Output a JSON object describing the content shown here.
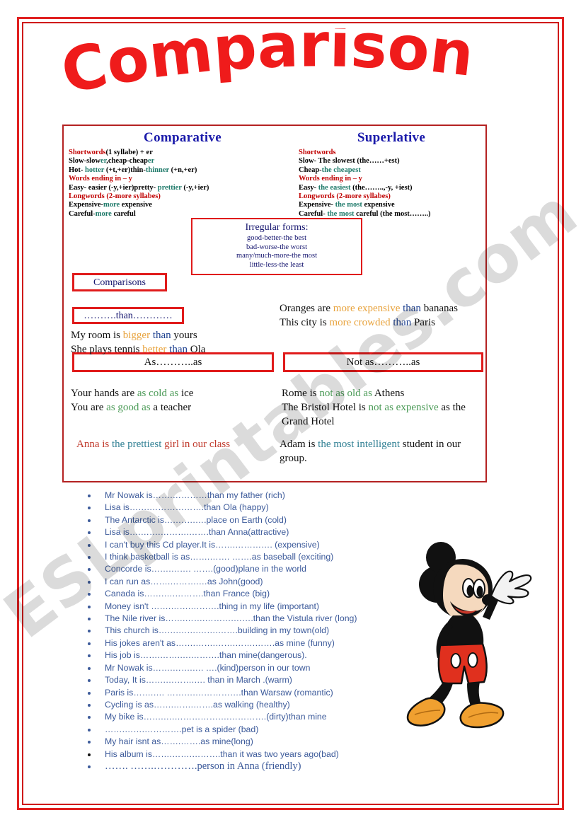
{
  "page": {
    "title": "Comparisons",
    "border_color": "#e02020",
    "box_border_color": "#b42222",
    "watermark": "ESLprintables.com"
  },
  "grammar_box": {
    "columns": [
      {
        "heading": "Comparative",
        "rules": [
          {
            "red": "Shortwords",
            "black": "(1 syllabe) + er"
          },
          {
            "black": "Slow-slow",
            "teal": "er",
            "black2": ",cheap-cheap",
            "teal2": "er"
          },
          {
            "black": "Hot- ",
            "teal": "hotter",
            "black2": " (+t,+er)thin-",
            "teal2": "thinner",
            "black3": " (+n,+er)"
          },
          {
            "red": "Words ending in – y"
          },
          {
            "black": "Easy- easier (-y,+ier)pretty- ",
            "teal": "prettier",
            "black2": " (-y,+ier)"
          },
          {
            "red": "Longwords (2-more syllabes)"
          },
          {
            "black": "Expensive-",
            "teal": "more",
            "black2": " expensive"
          },
          {
            "black": "Careful-",
            "teal": "more",
            "black2": " careful"
          }
        ]
      },
      {
        "heading": "Superlative",
        "rules": [
          {
            "red": "Shortwords"
          },
          {
            "black": "Slow- The slowest (the……+est)"
          },
          {
            "black": "Cheap-",
            "teal": "the cheapest"
          },
          {
            "red": "Words ending in – y"
          },
          {
            "black": "Easy- ",
            "teal": "the easiest",
            "black2": " (the……..,-y, +iest)"
          },
          {
            "red": "Longwords (2-more syllabes)"
          },
          {
            "black": "Expensive- ",
            "teal": "the most",
            "black2": " expensive"
          },
          {
            "black": "Careful- ",
            "teal": "the most",
            "black2": " careful (the most……..)"
          }
        ]
      }
    ],
    "irregular": {
      "heading": "Irregular forms:",
      "lines": [
        "good-better-the best",
        "bad-worse-the worst",
        "many/much-more-the most",
        "little-less-the least"
      ]
    },
    "labels": {
      "comparisons": "Comparisons",
      "than": "……….than…………",
      "as_as": "As………..as",
      "not_as_as": "Not   as………..as"
    },
    "examples": {
      "than_left": [
        {
          "a": "My room is ",
          "hl": "bigger",
          "b": " ",
          "blue": "than",
          "c": " yours"
        },
        {
          "a": "She plays tennis ",
          "hl": "better",
          "b": " ",
          "blue": "than",
          "c": " Ola"
        }
      ],
      "than_right": [
        {
          "a": "Oranges are ",
          "hl": "more expensive",
          "b": " ",
          "blue": "than",
          "c": " bananas"
        },
        {
          "a": "This city is ",
          "hl": "more crowded",
          "b": " ",
          "blue": "than",
          "c": " Paris"
        }
      ],
      "as_as": [
        {
          "a": "Your hands are ",
          "hl": "as cold as",
          "b": " ice"
        },
        {
          "a": "You are ",
          "hl": "as good as",
          "b": "  a teacher"
        }
      ],
      "not_as_as": [
        {
          "a": "Rome is ",
          "hl": "not as old as",
          "b": " Athens"
        },
        {
          "a": "The Bristol Hotel is ",
          "hl": "not as expensive",
          "b": "  as the Grand Hotel"
        }
      ],
      "superlative_left": {
        "a": "Anna is ",
        "hl": "the prettiest",
        "b": " girl in our class"
      },
      "superlative_right": {
        "a": "Adam is ",
        "hl": "the most intelligent",
        "b": " student in our group."
      }
    }
  },
  "exercises": [
    "Mr Nowak is…….…………than my father (rich)",
    "Lisa is…….……………….than Ola (happy)",
    "The Antarctic is….…….….place on Earth (cold)",
    "Lisa is….…….……….…….than Anna(attractive)",
    "I can't buy this Cd player.It is…….…………. (expensive)",
    "I think basketball is as…….……. …….as baseball (exciting)",
    "Concorde is…….……. …….(good)plane in the world",
    "I can run as…….……….…as John(good)",
    "Canada is…….….……….than France (big)",
    "Money isn't …….…….……….thing in my life (important)",
    "The Nile river is…….…….……….…….than the Vistula river (long)",
    "This church is…….…….…….…….building in my town(old)",
    "His jokes aren't  as…….…….…….…….…….as mine (funny)",
    "His job is…….…….….……….than mine(dangerous).",
    "Mr Nowak is…….…….…. ….(kind)person in our town",
    "Today, It is…….……….…. than in March .(warm)",
    "Paris is…….…. ……….…………….than Warsaw (romantic)",
    "Cycling is as…….…….…….as walking (healthy)",
    "My bike is…….….……………….………….(dirty)than mine",
    "…….…….………….pet is a spider (bad)",
    "My hair isnt as…….…….as mine(long)",
    "His album is…….…….……….than it was  two years ago(bad)",
    "……. …….………….person in Anna (friendly)"
  ],
  "image": {
    "character": "mickey-mouse",
    "colors": {
      "body": "#111111",
      "shorts": "#e0301e",
      "shoes": "#f0a030",
      "face": "#f5d9be",
      "glove": "#f2f2f2"
    }
  }
}
